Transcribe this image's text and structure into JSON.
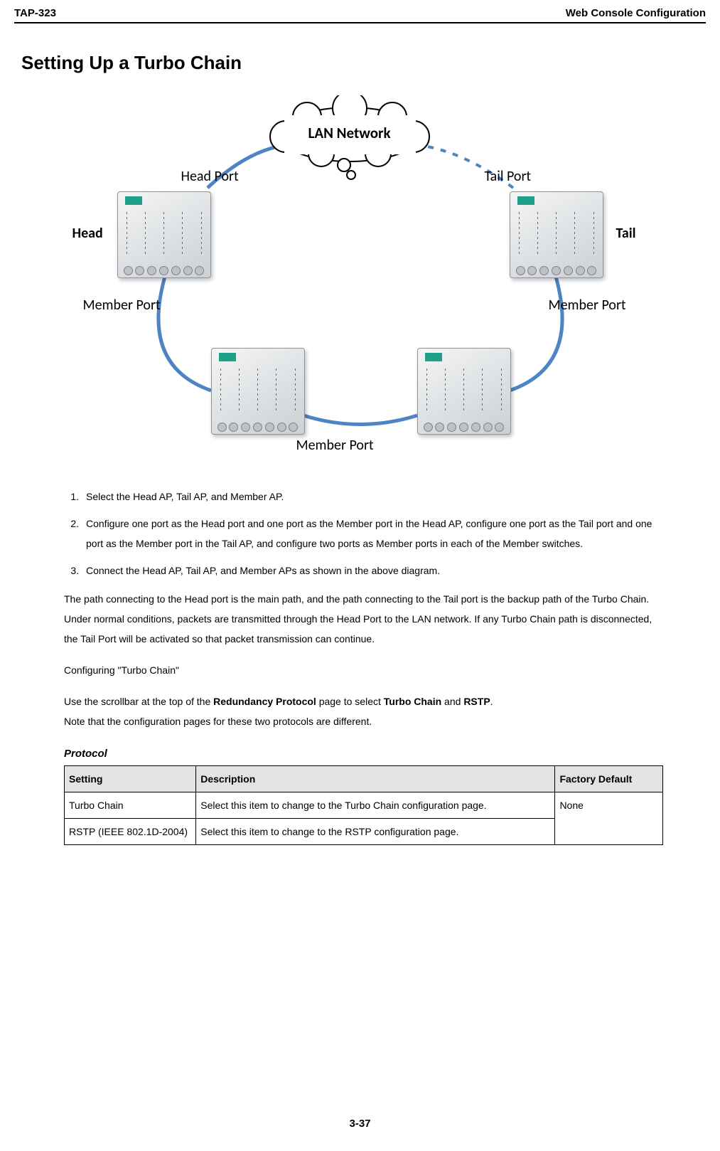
{
  "header": {
    "left": "TAP-323",
    "right": "Web Console Configuration"
  },
  "section_title": "Setting Up a Turbo Chain",
  "diagram": {
    "cloud_label": "LAN Network",
    "head_port": "Head Port",
    "tail_port": "Tail Port",
    "head": "Head",
    "tail": "Tail",
    "member_port_left": "Member Port",
    "member_port_right": "Member Port",
    "member_port_bottom": "Member Port"
  },
  "steps": [
    "Select the Head AP, Tail AP, and Member AP.",
    "Configure one port as the Head port and one port as the Member port in the Head AP, configure one port as the Tail port and one port as the Member port in the Tail AP, and configure two ports as Member ports in each of the Member switches.",
    "Connect the Head AP, Tail AP, and Member APs as shown in the above diagram."
  ],
  "paragraph_main": "The path connecting to the Head port is the main path, and the path connecting to the Tail port is the backup path of the Turbo Chain. Under normal conditions, packets are transmitted through the Head Port to the LAN network. If any Turbo Chain path is disconnected, the Tail Port will be activated so that packet transmission can continue.",
  "subheading": "Configuring \"Turbo Chain\"",
  "paragraph_use_pre": "Use the scrollbar at the top of the ",
  "paragraph_use_bold1": "Redundancy Protocol",
  "paragraph_use_mid": " page to select ",
  "paragraph_use_bold2": "Turbo Chain",
  "paragraph_use_and": " and ",
  "paragraph_use_bold3": "RSTP",
  "paragraph_use_post": ".",
  "paragraph_note": "Note that the configuration pages for these two protocols are different.",
  "protocol_title": "Protocol",
  "table": {
    "head": {
      "setting": "Setting",
      "desc": "Description",
      "def": "Factory Default"
    },
    "rows": [
      {
        "setting": "Turbo Chain",
        "desc": "Select this item to change to the Turbo Chain configuration page.",
        "def": "None"
      },
      {
        "setting": "RSTP (IEEE 802.1D-2004)",
        "desc": "Select this item to change to the RSTP configuration page.",
        "def": ""
      }
    ]
  },
  "footer": "3-37"
}
